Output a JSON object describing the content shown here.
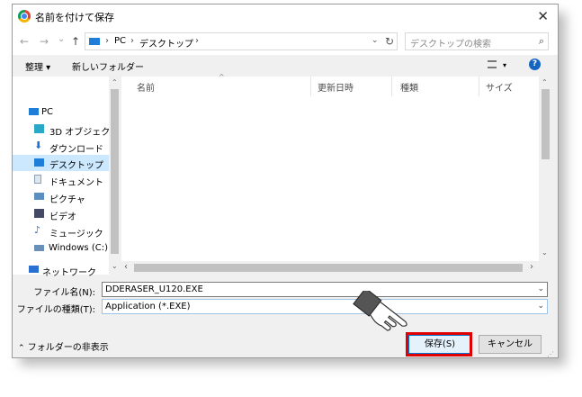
{
  "window": {
    "title": "名前を付けて保存",
    "close": "✕"
  },
  "nav": {
    "back": "←",
    "forward": "→",
    "recent": "⌄",
    "up": "↑",
    "breadcrumb": [
      "PC",
      "デスクトップ"
    ],
    "sep": "›",
    "refresh": "↻",
    "search_placeholder": "デスクトップの検索",
    "search_icon": "⌕"
  },
  "toolbar": {
    "organize": "整理 ▾",
    "new_folder": "新しいフォルダー",
    "view": "▾",
    "help": "?"
  },
  "sidebar": {
    "items": [
      {
        "label": "PC",
        "icon": "pc-icon",
        "color": "#1f7fd8"
      },
      {
        "label": "3D オブジェクト",
        "icon": "cube-icon",
        "color": "#2aa8c8"
      },
      {
        "label": "ダウンロード",
        "icon": "download-icon",
        "color": "#1f6fd0"
      },
      {
        "label": "デスクトップ",
        "icon": "desktop-icon",
        "color": "#1f7fd8",
        "selected": true
      },
      {
        "label": "ドキュメント",
        "icon": "document-icon",
        "color": "#8aa0b8"
      },
      {
        "label": "ピクチャ",
        "icon": "pictures-icon",
        "color": "#5a8fc0"
      },
      {
        "label": "ビデオ",
        "icon": "video-icon",
        "color": "#444a66"
      },
      {
        "label": "ミュージック",
        "icon": "music-icon",
        "color": "#2a70d0"
      },
      {
        "label": "Windows (C:)",
        "icon": "drive-icon",
        "color": "#6a8fb8"
      },
      {
        "label": "ネットワーク",
        "icon": "network-icon",
        "color": "#2a70d0"
      }
    ]
  },
  "columns": {
    "name": "名前",
    "modified": "更新日時",
    "type": "種類",
    "size": "サイズ"
  },
  "form": {
    "filename_label": "ファイル名(N):",
    "filename_value": "DDERASER_U120.EXE",
    "filetype_label": "ファイルの種類(T):",
    "filetype_value": "Application (*.EXE)",
    "dropdown": "⌄"
  },
  "footer": {
    "hide_folders": "フォルダーの非表示",
    "save": "保存(S)",
    "cancel": "キャンセル"
  },
  "colors": {
    "highlight": "#e00000",
    "accent": "#0078d7",
    "selection": "#cce8ff"
  }
}
